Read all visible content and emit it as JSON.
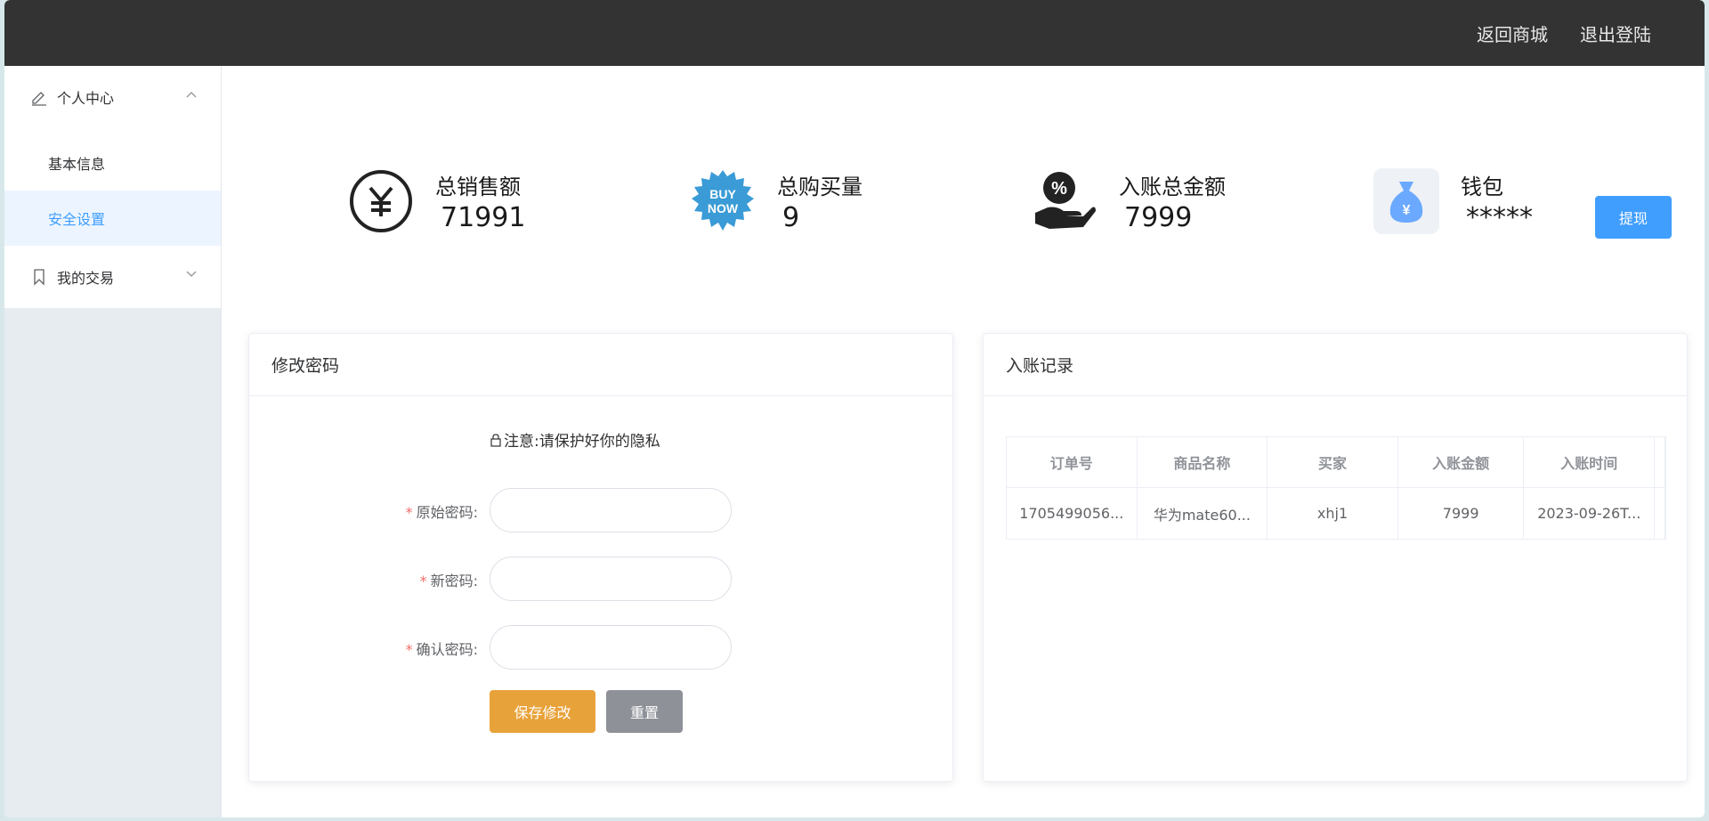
{
  "header": {
    "back_to_shop": "返回商城",
    "logout": "退出登陆",
    "bg_color": "#333333"
  },
  "sidebar": {
    "groups": [
      {
        "label": "个人中心",
        "icon": "edit-icon",
        "expanded": true,
        "items": [
          {
            "label": "基本信息",
            "active": false
          },
          {
            "label": "安全设置",
            "active": true
          }
        ]
      },
      {
        "label": "我的交易",
        "icon": "bookmark-icon",
        "expanded": false,
        "items": []
      }
    ],
    "active_color": "#409eff"
  },
  "stats": [
    {
      "title": "总销售额",
      "value": "71991",
      "icon": "yuan-circle-icon"
    },
    {
      "title": "总购买量",
      "value": "9",
      "icon": "buy-now-badge-icon",
      "badge_text_1": "BUY",
      "badge_text_2": "NOW"
    },
    {
      "title": "入账总金额",
      "value": "7999",
      "icon": "percent-hand-icon"
    },
    {
      "title": "钱包",
      "value": "*****",
      "icon": "money-bag-icon"
    }
  ],
  "withdraw_button": "提现",
  "password_card": {
    "title": "修改密码",
    "notice": "注意:请保护好你的隐私",
    "fields": [
      {
        "label": "原始密码:",
        "value": ""
      },
      {
        "label": "新密码:",
        "value": ""
      },
      {
        "label": "确认密码:",
        "value": ""
      }
    ],
    "save_button": "保存修改",
    "reset_button": "重置"
  },
  "records_card": {
    "title": "入账记录",
    "columns": [
      "订单号",
      "商品名称",
      "买家",
      "入账金额",
      "入账时间"
    ],
    "rows": [
      [
        "1705499056...",
        "华为mate60...",
        "xhj1",
        "7999",
        "2023-09-26T..."
      ]
    ]
  }
}
